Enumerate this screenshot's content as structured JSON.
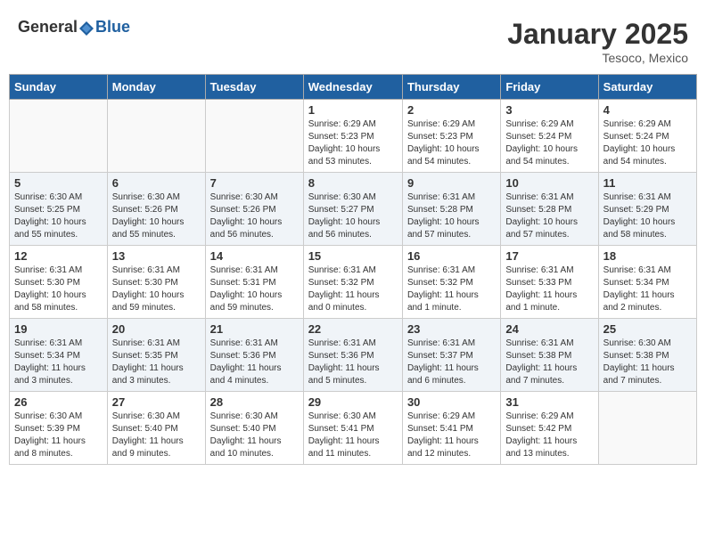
{
  "header": {
    "logo": {
      "general": "General",
      "blue": "Blue"
    },
    "month": "January 2025",
    "location": "Tesoco, Mexico"
  },
  "weekdays": [
    "Sunday",
    "Monday",
    "Tuesday",
    "Wednesday",
    "Thursday",
    "Friday",
    "Saturday"
  ],
  "weeks": [
    [
      {
        "day": "",
        "info": ""
      },
      {
        "day": "",
        "info": ""
      },
      {
        "day": "",
        "info": ""
      },
      {
        "day": "1",
        "info": "Sunrise: 6:29 AM\nSunset: 5:23 PM\nDaylight: 10 hours\nand 53 minutes."
      },
      {
        "day": "2",
        "info": "Sunrise: 6:29 AM\nSunset: 5:23 PM\nDaylight: 10 hours\nand 54 minutes."
      },
      {
        "day": "3",
        "info": "Sunrise: 6:29 AM\nSunset: 5:24 PM\nDaylight: 10 hours\nand 54 minutes."
      },
      {
        "day": "4",
        "info": "Sunrise: 6:29 AM\nSunset: 5:24 PM\nDaylight: 10 hours\nand 54 minutes."
      }
    ],
    [
      {
        "day": "5",
        "info": "Sunrise: 6:30 AM\nSunset: 5:25 PM\nDaylight: 10 hours\nand 55 minutes."
      },
      {
        "day": "6",
        "info": "Sunrise: 6:30 AM\nSunset: 5:26 PM\nDaylight: 10 hours\nand 55 minutes."
      },
      {
        "day": "7",
        "info": "Sunrise: 6:30 AM\nSunset: 5:26 PM\nDaylight: 10 hours\nand 56 minutes."
      },
      {
        "day": "8",
        "info": "Sunrise: 6:30 AM\nSunset: 5:27 PM\nDaylight: 10 hours\nand 56 minutes."
      },
      {
        "day": "9",
        "info": "Sunrise: 6:31 AM\nSunset: 5:28 PM\nDaylight: 10 hours\nand 57 minutes."
      },
      {
        "day": "10",
        "info": "Sunrise: 6:31 AM\nSunset: 5:28 PM\nDaylight: 10 hours\nand 57 minutes."
      },
      {
        "day": "11",
        "info": "Sunrise: 6:31 AM\nSunset: 5:29 PM\nDaylight: 10 hours\nand 58 minutes."
      }
    ],
    [
      {
        "day": "12",
        "info": "Sunrise: 6:31 AM\nSunset: 5:30 PM\nDaylight: 10 hours\nand 58 minutes."
      },
      {
        "day": "13",
        "info": "Sunrise: 6:31 AM\nSunset: 5:30 PM\nDaylight: 10 hours\nand 59 minutes."
      },
      {
        "day": "14",
        "info": "Sunrise: 6:31 AM\nSunset: 5:31 PM\nDaylight: 10 hours\nand 59 minutes."
      },
      {
        "day": "15",
        "info": "Sunrise: 6:31 AM\nSunset: 5:32 PM\nDaylight: 11 hours\nand 0 minutes."
      },
      {
        "day": "16",
        "info": "Sunrise: 6:31 AM\nSunset: 5:32 PM\nDaylight: 11 hours\nand 1 minute."
      },
      {
        "day": "17",
        "info": "Sunrise: 6:31 AM\nSunset: 5:33 PM\nDaylight: 11 hours\nand 1 minute."
      },
      {
        "day": "18",
        "info": "Sunrise: 6:31 AM\nSunset: 5:34 PM\nDaylight: 11 hours\nand 2 minutes."
      }
    ],
    [
      {
        "day": "19",
        "info": "Sunrise: 6:31 AM\nSunset: 5:34 PM\nDaylight: 11 hours\nand 3 minutes."
      },
      {
        "day": "20",
        "info": "Sunrise: 6:31 AM\nSunset: 5:35 PM\nDaylight: 11 hours\nand 3 minutes."
      },
      {
        "day": "21",
        "info": "Sunrise: 6:31 AM\nSunset: 5:36 PM\nDaylight: 11 hours\nand 4 minutes."
      },
      {
        "day": "22",
        "info": "Sunrise: 6:31 AM\nSunset: 5:36 PM\nDaylight: 11 hours\nand 5 minutes."
      },
      {
        "day": "23",
        "info": "Sunrise: 6:31 AM\nSunset: 5:37 PM\nDaylight: 11 hours\nand 6 minutes."
      },
      {
        "day": "24",
        "info": "Sunrise: 6:31 AM\nSunset: 5:38 PM\nDaylight: 11 hours\nand 7 minutes."
      },
      {
        "day": "25",
        "info": "Sunrise: 6:30 AM\nSunset: 5:38 PM\nDaylight: 11 hours\nand 7 minutes."
      }
    ],
    [
      {
        "day": "26",
        "info": "Sunrise: 6:30 AM\nSunset: 5:39 PM\nDaylight: 11 hours\nand 8 minutes."
      },
      {
        "day": "27",
        "info": "Sunrise: 6:30 AM\nSunset: 5:40 PM\nDaylight: 11 hours\nand 9 minutes."
      },
      {
        "day": "28",
        "info": "Sunrise: 6:30 AM\nSunset: 5:40 PM\nDaylight: 11 hours\nand 10 minutes."
      },
      {
        "day": "29",
        "info": "Sunrise: 6:30 AM\nSunset: 5:41 PM\nDaylight: 11 hours\nand 11 minutes."
      },
      {
        "day": "30",
        "info": "Sunrise: 6:29 AM\nSunset: 5:41 PM\nDaylight: 11 hours\nand 12 minutes."
      },
      {
        "day": "31",
        "info": "Sunrise: 6:29 AM\nSunset: 5:42 PM\nDaylight: 11 hours\nand 13 minutes."
      },
      {
        "day": "",
        "info": ""
      }
    ]
  ]
}
